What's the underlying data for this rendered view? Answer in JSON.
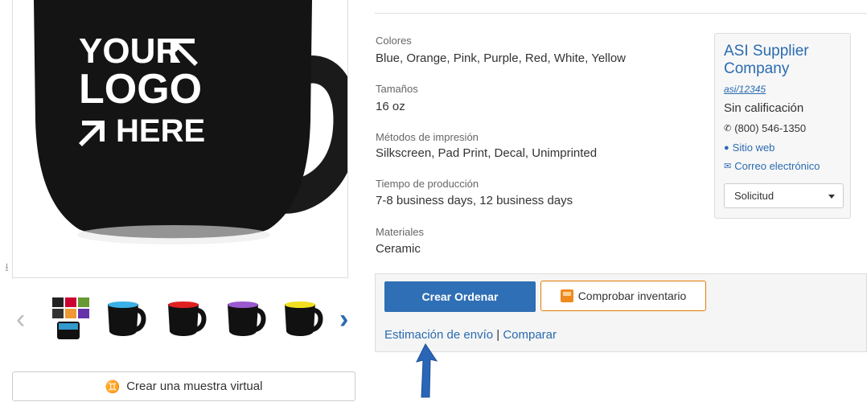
{
  "gallery": {
    "mug_logo_lines": [
      "YOUR",
      "LOGO",
      "HERE"
    ],
    "virtual_sample_label": "Crear una muestra virtual"
  },
  "details": [
    {
      "label": "Colores",
      "value": "Blue, Orange, Pink, Purple, Red, White, Yellow"
    },
    {
      "label": "Tamaños",
      "value": "16 oz"
    },
    {
      "label": "Métodos de impresión",
      "value": "Silkscreen, Pad Print, Decal, Unimprinted"
    },
    {
      "label": "Tiempo de producción",
      "value": "7-8 business days, 12 business days"
    },
    {
      "label": "Materiales",
      "value": "Ceramic"
    }
  ],
  "supplier": {
    "name": "ASI Supplier Company",
    "asi": "asi/12345",
    "rating": "Sin calificación",
    "phone": "(800) 546-1350",
    "website": "Sitio web",
    "email": "Correo electrónico",
    "request_select": "Solicitud"
  },
  "actions": {
    "order_button": "Crear Ordenar",
    "inventory_button": "Comprobar inventario",
    "shipping_link": "Estimación de envío",
    "separator": "|",
    "compare_link": "Comparar"
  },
  "colors": {
    "link": "#2a6bb1",
    "primary_button": "#2f6fb5",
    "inventory_border": "#e07b00",
    "annotation_arrow": "#2a66b8"
  },
  "icons": [
    "download-icon",
    "chevron-left-icon",
    "chevron-right-icon",
    "virtual-sample-icon",
    "phone-icon",
    "globe-icon",
    "envelope-icon",
    "caret-down-icon",
    "inventory-box-icon"
  ]
}
